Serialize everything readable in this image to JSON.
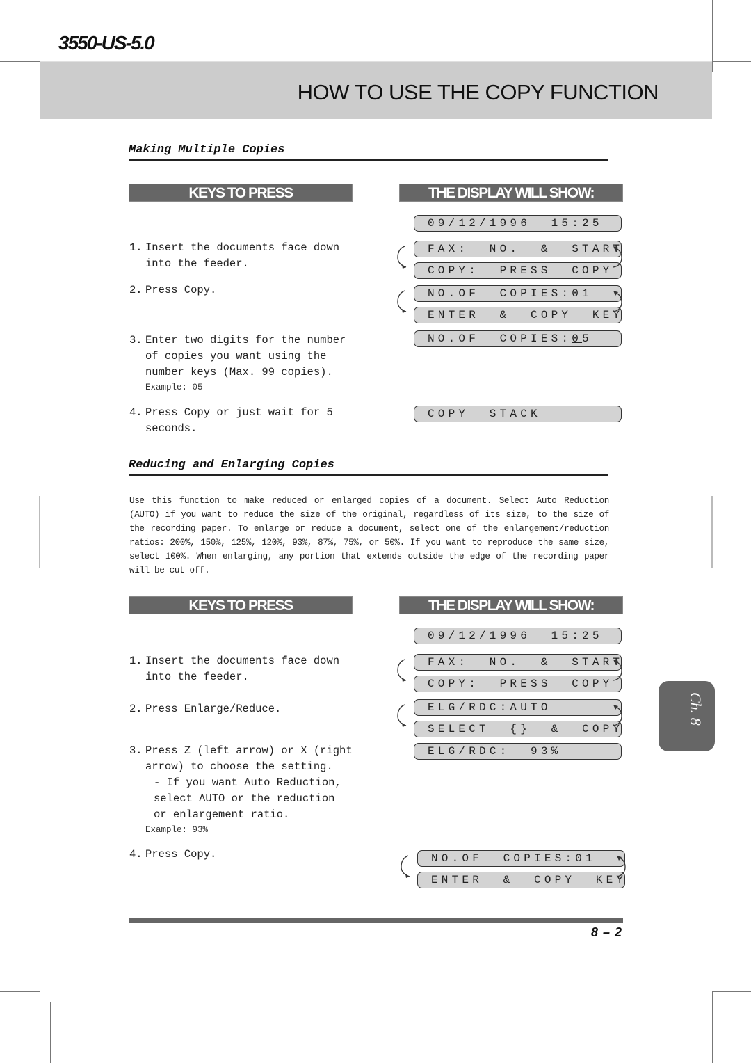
{
  "doc_id": "3550-US-5.0",
  "banner_title": "HOW TO USE THE COPY FUNCTION",
  "sections": [
    {
      "title": "Making Multiple Copies",
      "keys_header": "KEYS TO PRESS",
      "display_header": "THE DISPLAY WILL SHOW:",
      "steps": [
        {
          "num": "1.",
          "text": "Insert the documents face down into the feeder."
        },
        {
          "num": "2.",
          "text": "Press Copy."
        },
        {
          "num": "3.",
          "text": "Enter two digits for the number of copies you want using the number keys (Max. 99 copies).",
          "example": "Example: 05"
        },
        {
          "num": "4.",
          "text": "Press Copy or just wait for 5 seconds."
        }
      ],
      "displays": {
        "idle": "09/12/1996  15:25",
        "cycle1_a": "FAX:  NO.  &  START",
        "cycle1_b": "COPY:  PRESS  COPY",
        "cycle2_a": "NO.OF  COPIES:01",
        "cycle2_b": "ENTER  &  COPY  KEY",
        "entered_prefix": "NO.OF  COPIES:",
        "entered_cursor": "0",
        "entered_suffix": "5",
        "final": "COPY  STACK"
      }
    },
    {
      "title": "Reducing and Enlarging Copies",
      "intro": "Use this function to make reduced or enlarged copies of a document.  Select Auto Reduction (AUTO) if you want to reduce the size of the original, regardless of its size, to the size of the recording paper.  To enlarge or reduce a document, select one of the enlargement/reduction ratios: 200%, 150%, 125%, 120%, 93%, 87%, 75%, or 50%.  If you want to reproduce the same size, select 100%. When enlarging, any portion that extends outside the edge of the recording paper will be cut off.",
      "keys_header": "KEYS TO PRESS",
      "display_header": "THE DISPLAY WILL SHOW:",
      "steps": [
        {
          "num": "1.",
          "text": "Insert the documents face down into the feeder."
        },
        {
          "num": "2.",
          "text": "Press Enlarge/Reduce."
        },
        {
          "num": "3.",
          "text": "Press Z (left arrow) or X (right arrow) to choose the setting.",
          "sub": "- If you want Auto Reduction, select AUTO or the reduction or enlargement ratio.",
          "example": "Example: 93%"
        },
        {
          "num": "4.",
          "text": "Press Copy."
        }
      ],
      "displays": {
        "idle": "09/12/1996  15:25",
        "cycle1_a": "FAX:  NO.  &  START",
        "cycle1_b": "COPY:  PRESS  COPY",
        "cycle2_a": "ELG/RDC:AUTO",
        "cycle2_b": "SELECT  {}  &  COPY",
        "selected": "ELG/RDC:  93%",
        "cycle3_a": "NO.OF  COPIES:01",
        "cycle3_b": "ENTER  &  COPY  KEY"
      }
    }
  ],
  "chapter_tab": "Ch. 8",
  "page_number": "8 – 2"
}
